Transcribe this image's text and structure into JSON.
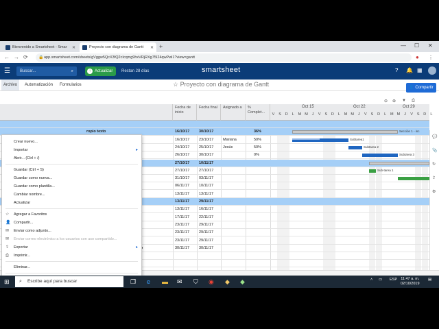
{
  "browser": {
    "tabs": [
      {
        "title": "Bienvenido a Smartsheet - Smar",
        "active": false
      },
      {
        "title": "Proyecto con diagrama de Gantt",
        "active": true
      }
    ],
    "new_tab": "+",
    "window_controls": [
      "—",
      "☐",
      "✕"
    ],
    "url": "app.smartsheet.com/sheets/gVggw5QcX3fQ2cIcqmg9hxVRjRXg75I24qwPwl1?view=gantt",
    "nav": [
      "←",
      "→",
      "⟳"
    ]
  },
  "header": {
    "search_placeholder": "Buscar...",
    "search_icon": "⌕",
    "new_icon": "+",
    "update_button": "Actualizar",
    "update_icon": "↑",
    "trial_text": "Restan 28 días",
    "logo": "smartsheet",
    "icons": [
      "?",
      "🔔",
      "▦"
    ]
  },
  "menubar": {
    "items": [
      "Archivo",
      "Automatización",
      "Formularios"
    ],
    "sheet_title": "☆ Proyecto con diagrama de Gantt",
    "share_button": "Compartir",
    "share_icon": "👤"
  },
  "file_menu": {
    "items": [
      {
        "label": "Crear nuevo...",
        "icon": "",
        "submenu": false,
        "disabled": false
      },
      {
        "label": "Importar",
        "icon": "",
        "submenu": true,
        "disabled": false
      },
      {
        "label": "Abrir... (Ctrl + /)",
        "icon": "",
        "submenu": false,
        "disabled": false
      },
      {
        "sep": true
      },
      {
        "label": "Guardar (Ctrl + S)",
        "icon": "",
        "submenu": false,
        "disabled": false
      },
      {
        "label": "Guardar como nueva...",
        "icon": "",
        "submenu": false,
        "disabled": false
      },
      {
        "label": "Guardar como plantilla...",
        "icon": "",
        "submenu": false,
        "disabled": false
      },
      {
        "label": "Cambiar nombre...",
        "icon": "",
        "submenu": false,
        "disabled": false
      },
      {
        "label": "Actualizar",
        "icon": "",
        "submenu": false,
        "disabled": false
      },
      {
        "sep": true
      },
      {
        "label": "Agregar a Favoritos",
        "icon": "☆",
        "submenu": false,
        "disabled": false
      },
      {
        "label": "Compartir...",
        "icon": "👤",
        "submenu": false,
        "disabled": false
      },
      {
        "label": "Enviar como adjunto...",
        "icon": "✉",
        "submenu": false,
        "disabled": false
      },
      {
        "label": "Enviar correo electrónico a los usuarios con uso compartido...",
        "icon": "✉",
        "submenu": false,
        "disabled": true
      },
      {
        "label": "Exportar",
        "icon": "⇪",
        "submenu": true,
        "disabled": false
      },
      {
        "label": "Imprimir...",
        "icon": "⎙",
        "submenu": false,
        "disabled": false
      },
      {
        "sep": true
      },
      {
        "label": "Eliminar...",
        "icon": "",
        "submenu": false,
        "disabled": false
      },
      {
        "sep": true
      },
      {
        "label": "Ver registro de actividad...",
        "icon": "↻",
        "submenu": false,
        "disabled": false
      },
      {
        "label": "Propiedades...",
        "icon": "",
        "submenu": false,
        "disabled": false
      }
    ],
    "submenu_arrow": "▸"
  },
  "grid": {
    "columns": [
      "Fecha de inicio",
      "Fecha final",
      "Asignado a",
      "% Complet..."
    ],
    "months": [
      "Oct 15",
      "Oct 22",
      "Oct 29"
    ],
    "day_letters": [
      "V",
      "S",
      "D",
      "L",
      "M",
      "M",
      "J",
      "V",
      "S",
      "D",
      "L",
      "M",
      "M",
      "J",
      "V",
      "S",
      "D",
      "L",
      "M",
      "M",
      "J",
      "V",
      "S",
      "D",
      "L"
    ],
    "rows": [
      {
        "task": "",
        "start": "",
        "end": "",
        "assigned": "",
        "pct": "",
        "blue": true
      },
      {
        "task": "ropio texto",
        "start": "16/10/17",
        "end": "30/10/17",
        "assigned": "",
        "pct": "36%",
        "blue": true
      },
      {
        "task": "",
        "start": "16/10/17",
        "end": "23/10/17",
        "assigned": "Mariana",
        "pct": "50%",
        "blue": false
      },
      {
        "task": "",
        "start": "24/10/17",
        "end": "25/10/17",
        "assigned": "Jesús",
        "pct": "50%",
        "blue": false
      },
      {
        "task": "",
        "start": "26/10/17",
        "end": "30/10/17",
        "assigned": "",
        "pct": "0%",
        "blue": false
      },
      {
        "task": "",
        "start": "27/10/17",
        "end": "10/11/17",
        "assigned": "",
        "pct": "",
        "blue": true
      },
      {
        "task": "",
        "start": "27/10/17",
        "end": "27/10/17",
        "assigned": "",
        "pct": "",
        "blue": false
      },
      {
        "task": "",
        "start": "31/10/17",
        "end": "03/11/17",
        "assigned": "",
        "pct": "",
        "blue": false
      },
      {
        "task": "",
        "start": "06/11/17",
        "end": "10/11/17",
        "assigned": "",
        "pct": "",
        "blue": false
      },
      {
        "task": "ero",
        "start": "13/11/17",
        "end": "13/11/17",
        "assigned": "",
        "pct": "",
        "blue": false
      },
      {
        "task": "",
        "start": "13/11/17",
        "end": "29/11/17",
        "assigned": "",
        "pct": "",
        "blue": true
      },
      {
        "task": "",
        "start": "13/11/17",
        "end": "16/11/17",
        "assigned": "",
        "pct": "",
        "blue": false
      },
      {
        "task": "",
        "start": "17/11/17",
        "end": "22/11/17",
        "assigned": "",
        "pct": "",
        "blue": false
      },
      {
        "task": "niveles",
        "start": "23/11/17",
        "end": "29/11/17",
        "assigned": "",
        "pct": "",
        "blue": false
      },
      {
        "task": "",
        "start": "23/11/17",
        "end": "29/11/17",
        "assigned": "",
        "pct": "",
        "blue": false
      },
      {
        "task": "Sub-sub-tarea 2",
        "start": "23/11/17",
        "end": "29/11/17",
        "assigned": "",
        "pct": "",
        "blue": false
      },
      {
        "task": "Ejemplo de hito - duración cero",
        "start": "30/11/17",
        "end": "30/11/17",
        "assigned": "",
        "pct": "",
        "blue": false
      },
      {
        "task": "",
        "start": "",
        "end": "",
        "assigned": "",
        "pct": "",
        "blue": false
      },
      {
        "task": "",
        "start": "",
        "end": "",
        "assigned": "",
        "pct": "",
        "blue": false
      }
    ],
    "bar_labels": [
      "Sección 1 - inc",
      "Subtarea1",
      "Subtarea 2",
      "Subtarea 3",
      "Sub-tarea 1"
    ]
  },
  "taskbar": {
    "search_text": "Escribe aquí para buscar",
    "start_icon": "⊞",
    "tray_lang": "ESP",
    "time": "11:47 a. m.",
    "date": "02/10/2019"
  },
  "colors": {
    "header": "#0b3c78",
    "accent": "#1e6bd6",
    "update": "#2b9b49",
    "row_blue": "#a5cff7",
    "bar_blue": "#1f66c1",
    "bar_green": "#3aa043"
  }
}
